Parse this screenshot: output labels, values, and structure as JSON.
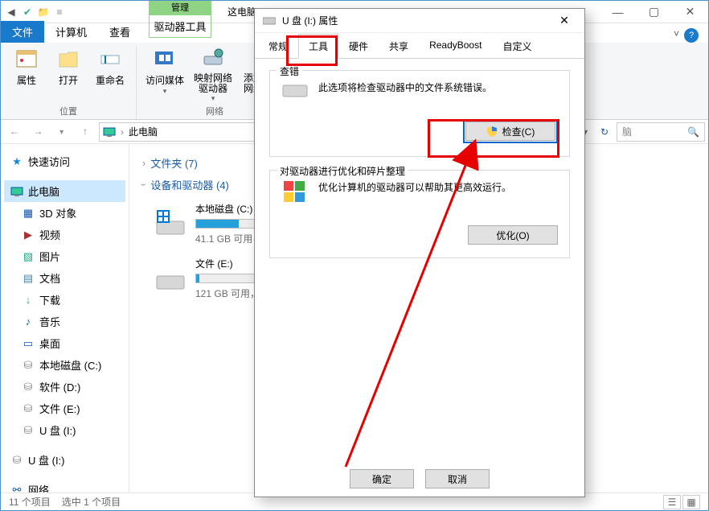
{
  "explorer": {
    "title": "这电脑",
    "ribbon": {
      "context_header": "管理",
      "context_tab": "驱动器工具",
      "tabs": {
        "file": "文件",
        "computer": "计算机",
        "view": "查看"
      },
      "group1": {
        "label": "位置",
        "btn_properties": "属性",
        "btn_open": "打开",
        "btn_rename": "重命名"
      },
      "group2": {
        "label": "网络",
        "btn_media": "访问媒体",
        "btn_mapnet": "映射网络\n驱动器",
        "btn_addloc": "添加一个\n网络位置"
      }
    },
    "addressbar": {
      "location": "此电脑",
      "refresh_label": "↻"
    },
    "sidebar": {
      "quick_access": "快速访问",
      "this_pc": "此电脑",
      "items": [
        "3D 对象",
        "视频",
        "图片",
        "文档",
        "下载",
        "音乐",
        "桌面",
        "本地磁盘 (C:)",
        "软件 (D:)",
        "文件 (E:)",
        "U 盘 (I:)"
      ],
      "usb2": "U 盘 (I:)",
      "network": "网络"
    },
    "content": {
      "folders_header": "文件夹 (7)",
      "devices_header": "设备和驱动器 (4)",
      "drives": [
        {
          "name": "本地磁盘 (C:)",
          "free": "41.1 GB 可用，",
          "fill_pct": 60
        },
        {
          "name": "文件 (E:)",
          "free": "121 GB 可用，",
          "fill_pct": 5
        }
      ]
    },
    "statusbar": {
      "items": "11 个项目",
      "selected": "选中 1 个项目"
    },
    "search_hint": "脑"
  },
  "dialog": {
    "title": "U 盘 (I:) 属性",
    "tabs": {
      "general": "常规",
      "tools": "工具",
      "hardware": "硬件",
      "sharing": "共享",
      "readyboost": "ReadyBoost",
      "customize": "自定义"
    },
    "errorcheck": {
      "legend": "查错",
      "desc": "此选项将检查驱动器中的文件系统错误。",
      "button": "检查(C)"
    },
    "optimize": {
      "legend": "对驱动器进行优化和碎片整理",
      "desc": "优化计算机的驱动器可以帮助其更高效运行。",
      "button": "优化(O)"
    },
    "footer": {
      "ok": "确定",
      "cancel": "取消"
    }
  }
}
